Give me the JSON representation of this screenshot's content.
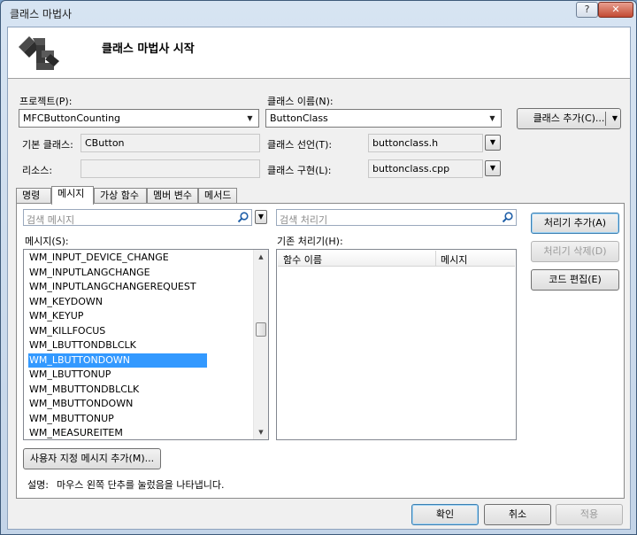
{
  "window": {
    "title": "클래스 마법사",
    "help_label": "?",
    "close_label": "✕"
  },
  "header": {
    "title": "클래스 마법사 시작",
    "icon": "class-wizard-icon"
  },
  "project": {
    "label": "프로젝트(P):",
    "value": "MFCButtonCounting"
  },
  "class_name": {
    "label": "클래스 이름(N):",
    "value": "ButtonClass"
  },
  "add_class_button": {
    "label": "클래스 추가(C)..."
  },
  "base_class": {
    "label": "기본 클래스:",
    "value": "CButton"
  },
  "class_declaration": {
    "label": "클래스 선언(T):",
    "value": "buttonclass.h"
  },
  "resource": {
    "label": "리소스:",
    "value": ""
  },
  "class_implementation": {
    "label": "클래스 구현(L):",
    "value": "buttonclass.cpp"
  },
  "tabs": [
    {
      "label": "명령",
      "active": false
    },
    {
      "label": "메시지",
      "active": true
    },
    {
      "label": "가상 함수",
      "active": false
    },
    {
      "label": "멤버 변수",
      "active": false
    },
    {
      "label": "메서드",
      "active": false
    }
  ],
  "message_search": {
    "placeholder": "검색 메시지"
  },
  "handler_search": {
    "placeholder": "검색 처리기"
  },
  "messages": {
    "label": "메시지(S):",
    "items": [
      "WM_INPUT_DEVICE_CHANGE",
      "WM_INPUTLANGCHANGE",
      "WM_INPUTLANGCHANGEREQUEST",
      "WM_KEYDOWN",
      "WM_KEYUP",
      "WM_KILLFOCUS",
      "WM_LBUTTONDBLCLK",
      "WM_LBUTTONDOWN",
      "WM_LBUTTONUP",
      "WM_MBUTTONDBLCLK",
      "WM_MBUTTONDOWN",
      "WM_MBUTTONUP",
      "WM_MEASUREITEM"
    ],
    "selected_index": 7
  },
  "existing_handlers": {
    "label": "기존 처리기(H):",
    "columns": [
      "함수 이름",
      "메시지"
    ],
    "rows": []
  },
  "handler_buttons": {
    "add": "처리기 추가(A)",
    "delete": "처리기 삭제(D)",
    "edit": "코드 편집(E)"
  },
  "add_custom_message_button": {
    "label": "사용자 지정 메시지 추가(M)..."
  },
  "description": {
    "label": "설명:",
    "text": "마우스 왼쪽 단추를 눌렀음을 나타냅니다."
  },
  "footer": {
    "ok": "확인",
    "cancel": "취소",
    "apply": "적용"
  },
  "colors": {
    "selection": "#3399ff",
    "window_frame": "#c3d4e8",
    "close_button": "#c24a33"
  }
}
